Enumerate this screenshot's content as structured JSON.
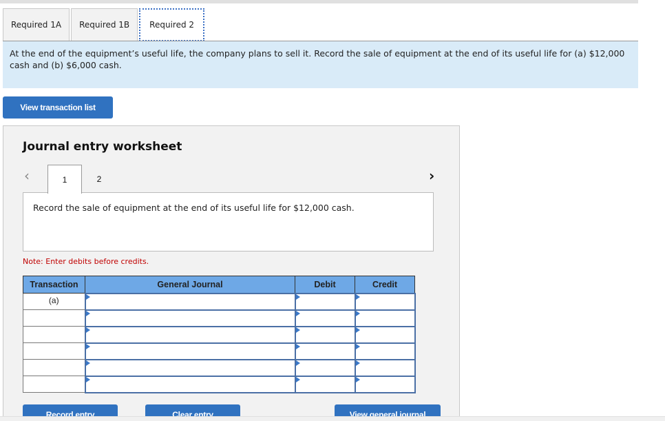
{
  "tabs": [
    {
      "label": "Required 1A",
      "active": false
    },
    {
      "label": "Required 1B",
      "active": false
    },
    {
      "label": "Required 2",
      "active": true
    }
  ],
  "instructions": "At the end of the equipment’s useful life, the company plans to sell it. Record the sale of equipment at the end of its useful life for (a) $12,000 cash and (b) $6,000 cash.",
  "view_transaction_list_label": "View transaction list",
  "worksheet": {
    "title": "Journal entry worksheet",
    "nav_prev_icon": "‹",
    "nav_next_icon": "›",
    "pages": [
      "1",
      "2"
    ],
    "active_page": "1",
    "prompt": "Record the sale of equipment at the end of its useful life for $12,000 cash.",
    "note": "Note: Enter debits before credits.",
    "table": {
      "headers": [
        "Transaction",
        "General Journal",
        "Debit",
        "Credit"
      ],
      "rows": [
        {
          "transaction": "(a)",
          "account": "",
          "debit": "",
          "credit": ""
        },
        {
          "transaction": "",
          "account": "",
          "debit": "",
          "credit": ""
        },
        {
          "transaction": "",
          "account": "",
          "debit": "",
          "credit": ""
        },
        {
          "transaction": "",
          "account": "",
          "debit": "",
          "credit": ""
        },
        {
          "transaction": "",
          "account": "",
          "debit": "",
          "credit": ""
        },
        {
          "transaction": "",
          "account": "",
          "debit": "",
          "credit": ""
        }
      ]
    },
    "buttons": {
      "record": "Record entry",
      "clear": "Clear entry",
      "view_general_journal": "View general journal"
    }
  },
  "colors": {
    "accent_button": "#3072c0",
    "table_header": "#6ea8e6",
    "instruction_bg": "#d9ebf8",
    "note_text": "#c00000"
  }
}
